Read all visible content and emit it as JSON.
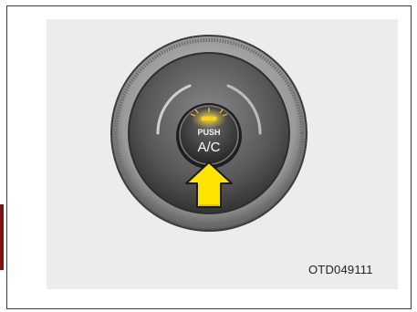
{
  "figure": {
    "button_push_label": "PUSH",
    "button_label": "A/C",
    "figure_code": "OTD049111"
  },
  "colors": {
    "indicator_light": "#f7d21e",
    "arrow_fill": "#ffe400",
    "side_tab": "#7a1414",
    "panel_background": "#ececec"
  },
  "icons": {
    "arrow": "up-arrow-icon",
    "indicator": "indicator-light-icon"
  }
}
